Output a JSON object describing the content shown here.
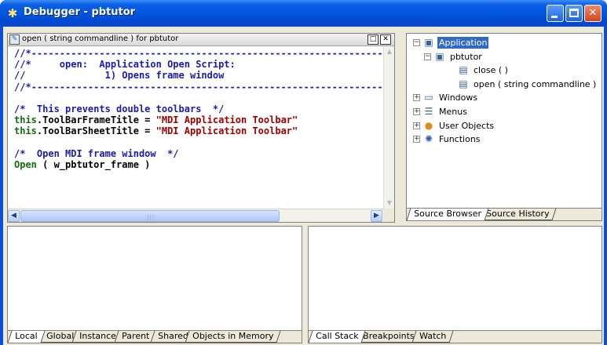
{
  "window": {
    "title": "Debugger - pbtutor",
    "icon": "debugger-bug-icon"
  },
  "script_pane": {
    "title": "open ( string commandline ) for pbtutor",
    "code_lines": [
      [
        {
          "t": "c",
          "v": "//*-----------------------------------------------------------------"
        }
      ],
      [
        {
          "t": "c",
          "v": "//*     open:  Application Open Script:"
        }
      ],
      [
        {
          "t": "c",
          "v": "//              1) Opens frame window"
        }
      ],
      [
        {
          "t": "c",
          "v": "//*-----------------------------------------------------------------"
        }
      ],
      [
        {
          "t": "d",
          "v": ""
        }
      ],
      [
        {
          "t": "c",
          "v": "/*  This prevents double toolbars  */"
        }
      ],
      [
        {
          "t": "k",
          "v": "this"
        },
        {
          "t": "d",
          "v": ".ToolBarFrameTitle = "
        },
        {
          "t": "s",
          "v": "\"MDI Application Toolbar\""
        }
      ],
      [
        {
          "t": "k",
          "v": "this"
        },
        {
          "t": "d",
          "v": ".ToolBarSheetTitle = "
        },
        {
          "t": "s",
          "v": "\"MDI Application Toolbar\""
        }
      ],
      [
        {
          "t": "d",
          "v": ""
        }
      ],
      [
        {
          "t": "c",
          "v": "/*  Open MDI frame window  */"
        }
      ],
      [
        {
          "t": "k",
          "v": "Open"
        },
        {
          "t": "d",
          "v": " ( w_pbtutor_frame )"
        }
      ]
    ]
  },
  "tree": {
    "nodes": [
      {
        "label": "Application",
        "icon": "application-icon",
        "expander": "minus",
        "selected": true
      },
      {
        "label": "pbtutor",
        "icon": "application-object-icon",
        "expander": "minus",
        "selected": false
      },
      {
        "label": "close ( )",
        "icon": "event-script-icon",
        "expander": "",
        "selected": false
      },
      {
        "label": "open ( string commandline )",
        "icon": "event-script-icon",
        "expander": "",
        "selected": false
      },
      {
        "label": "Windows",
        "icon": "window-icon",
        "expander": "plus",
        "selected": false
      },
      {
        "label": "Menus",
        "icon": "menu-icon",
        "expander": "plus",
        "selected": false
      },
      {
        "label": "User Objects",
        "icon": "user-object-icon",
        "expander": "plus",
        "selected": false
      },
      {
        "label": "Functions",
        "icon": "function-gear-icon",
        "expander": "plus",
        "selected": false
      }
    ],
    "tabs": [
      "Source Browser",
      "Source History"
    ]
  },
  "variables_tabs": [
    "Local",
    "Global",
    "Instance",
    "Parent",
    "Shared",
    "Objects in Memory"
  ],
  "callstack_tabs": [
    "Call Stack",
    "Breakpoints",
    "Watch"
  ]
}
